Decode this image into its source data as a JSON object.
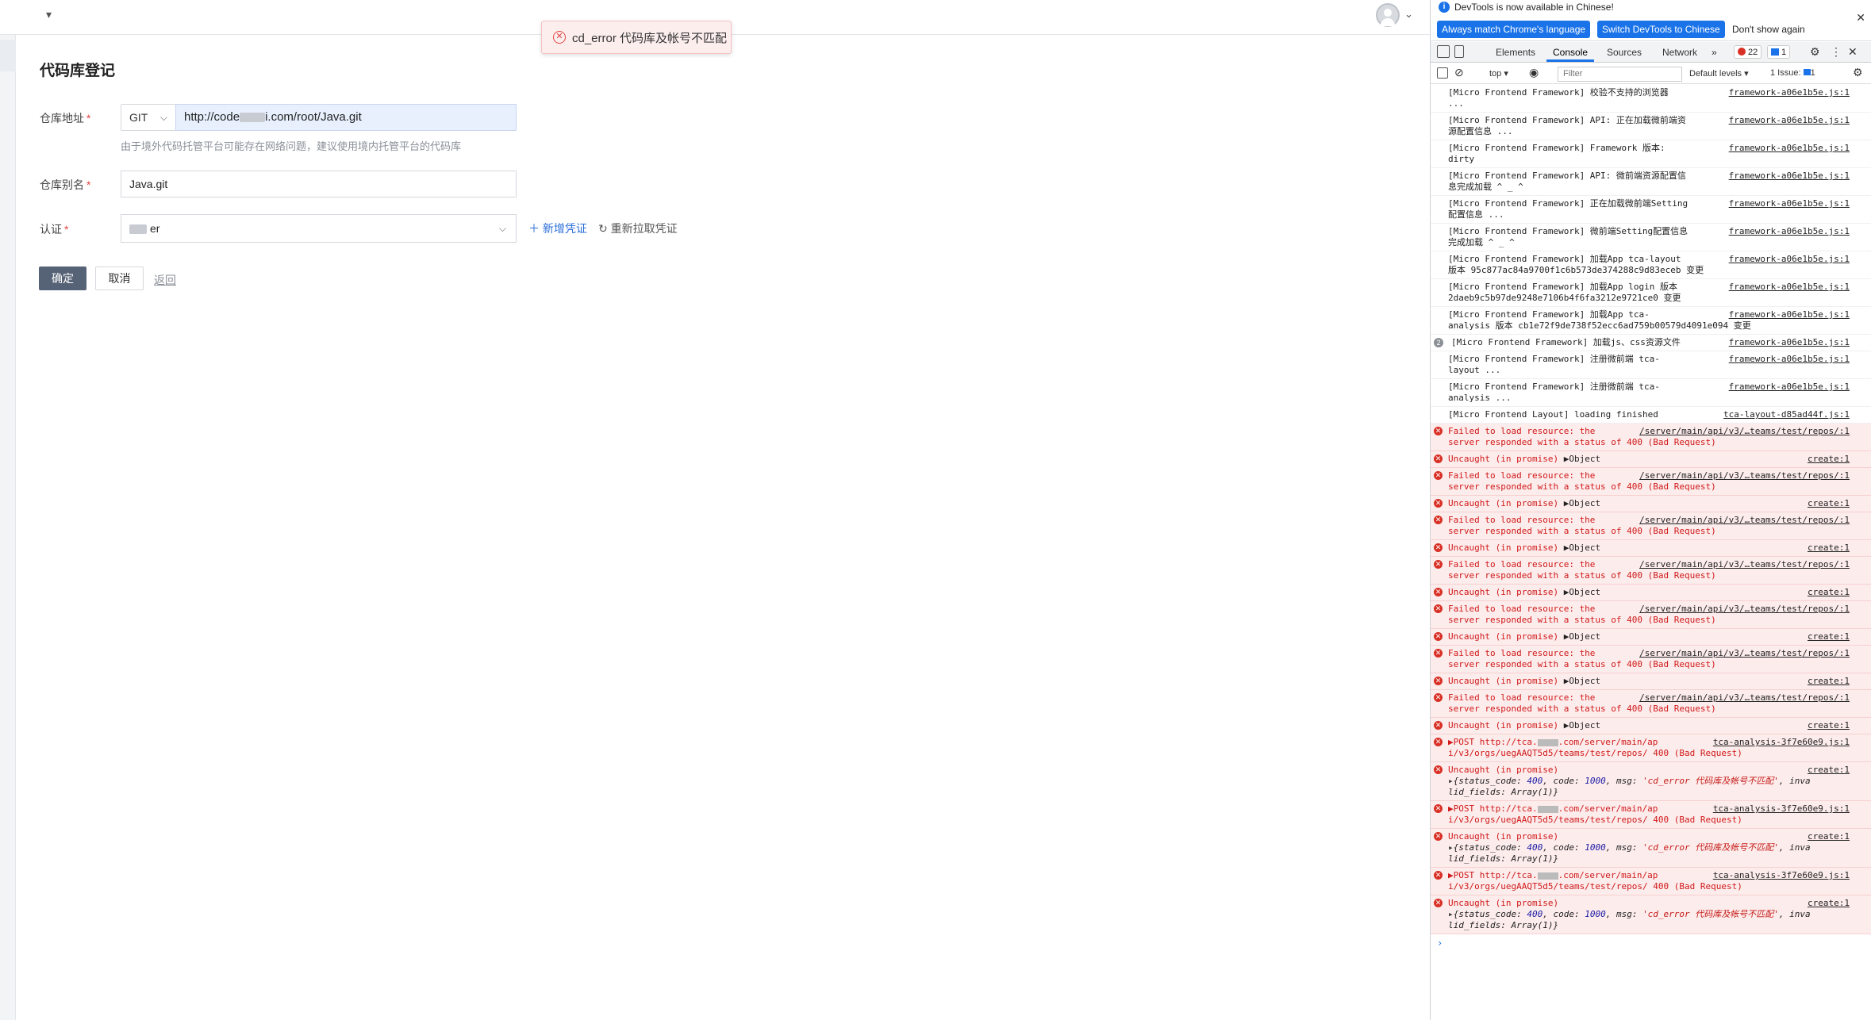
{
  "app": {
    "toast": {
      "text": "cd_error 代码库及帐号不匹配"
    },
    "page_title": "代码库登记",
    "form": {
      "repo_label": "仓库地址",
      "repo_type": "GIT",
      "repo_url_prefix": "http://code",
      "repo_url_suffix": "i.com/root/Java.git",
      "hint": "由于境外代码托管平台可能存在网络问题，建议使用境内托管平台的代码库",
      "alias_label": "仓库别名",
      "alias_value": "Java.git",
      "auth_label": "认证",
      "auth_value_suffix": "er",
      "add_credential": "新增凭证",
      "refresh_credential": "重新拉取凭证",
      "required_mark": "*"
    },
    "buttons": {
      "confirm": "确定",
      "cancel": "取消",
      "back": "返回"
    }
  },
  "devtools": {
    "banner": {
      "message": "DevTools is now available in Chinese!",
      "btn_match": "Always match Chrome's language",
      "btn_switch": "Switch DevTools to Chinese",
      "btn_dismiss": "Don't show again"
    },
    "tabs": [
      "Elements",
      "Console",
      "Sources",
      "Network"
    ],
    "active_tab": "Console",
    "more_tabs": "»",
    "error_count": "22",
    "message_count": "1",
    "toolbar": {
      "context": "top ▾",
      "filter_placeholder": "Filter",
      "levels": "Default levels ▾",
      "issues": "1 Issue:",
      "issues_count": "1"
    },
    "console": {
      "logs": [
        {
          "text": "[Micro Frontend Framework] 校验不支持的浏览器\n...",
          "src": "framework-a06e1b5e.js:1"
        },
        {
          "text": "[Micro Frontend Framework] API: 正在加载微前端资\n源配置信息 ...",
          "src": "framework-a06e1b5e.js:1"
        },
        {
          "text": "[Micro Frontend Framework] Framework 版本:\ndirty",
          "src": "framework-a06e1b5e.js:1"
        },
        {
          "text": "[Micro Frontend Framework] API: 微前端资源配置信\n息完成加载 ^ _ ^",
          "src": "framework-a06e1b5e.js:1"
        },
        {
          "text": "[Micro Frontend Framework] 正在加载微前端Setting\n配置信息 ...",
          "src": "framework-a06e1b5e.js:1"
        },
        {
          "text": "[Micro Frontend Framework] 微前端Setting配置信息\n完成加载 ^ _ ^",
          "src": "framework-a06e1b5e.js:1"
        },
        {
          "text": "[Micro Frontend Framework] 加载App tca-layout\n版本 95c877ac84a9700f1c6b573de374288c9d83eceb 变更",
          "src": "framework-a06e1b5e.js:1"
        },
        {
          "text": "[Micro Frontend Framework] 加载App login 版本\n2daeb9c5b97de9248e7106b4f6fa3212e9721ce0 变更",
          "src": "framework-a06e1b5e.js:1"
        },
        {
          "text": "[Micro Frontend Framework] 加载App tca-\nanalysis 版本 cb1e72f9de738f52ecc6ad759b00579d4091e094 变更",
          "src": "framework-a06e1b5e.js:1"
        },
        {
          "text": "[Micro Frontend Framework] 加载js、css资源文件",
          "src": "framework-a06e1b5e.js:1",
          "count": "2"
        },
        {
          "text": "[Micro Frontend Framework] 注册微前端 tca-\nlayout ...",
          "src": "framework-a06e1b5e.js:1"
        },
        {
          "text": "[Micro Frontend Framework] 注册微前端 tca-\nanalysis ...",
          "src": "framework-a06e1b5e.js:1"
        },
        {
          "text": "[Micro Frontend Layout] loading finished",
          "src": "tca-layout-d85ad44f.js:1"
        }
      ],
      "failed_text": "Failed to load resource: the\nserver responded with a status of 400 (Bad Request)",
      "failed_src": "/server/main/api/v3/…teams/test/repos/:1",
      "uncaught_text": "Uncaught (in promise) ",
      "uncaught_obj": "▶Object",
      "uncaught_src": "create:1",
      "post_text_a": "▶POST http://tca.",
      "post_text_b": ".com/server/main/ap\ni/v3/orgs/uegAAQT5d5/teams/test/repos/ 400 (Bad Request)",
      "post_src": "tca-analysis-3f7e60e9.js:1",
      "obj_line_a": "Uncaught (in promise)",
      "obj_src": "create:1",
      "obj_key1": "{status_code: ",
      "obj_val1": "400",
      "obj_key2": ", code: ",
      "obj_val2": "1000",
      "obj_key3": ", msg: ",
      "obj_val3": "'cd_error 代码库及帐号不匹配'",
      "obj_key4": ", inva\nlid_fields: Array(1)}",
      "error_icon": "x-circle-icon",
      "prompt": "›"
    }
  }
}
